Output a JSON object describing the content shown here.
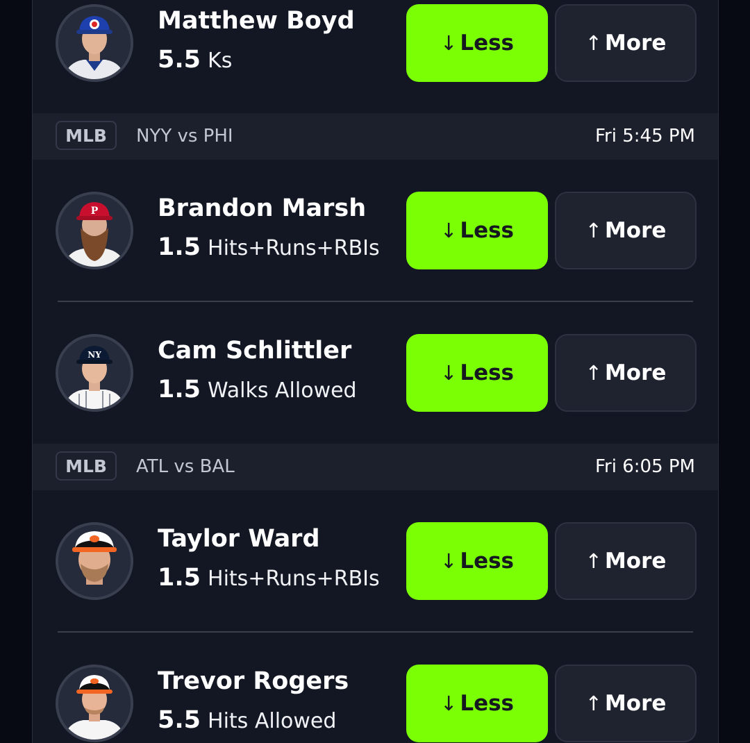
{
  "buttons": {
    "less": "Less",
    "more": "More",
    "less_arrow": "↓",
    "more_arrow": "↑"
  },
  "colors": {
    "less_button": "#7bff05",
    "background": "#131723",
    "header": "#1c202c"
  },
  "rows": [
    {
      "name": "Matthew Boyd",
      "line": "5.5",
      "stat": "Ks",
      "team_cap": "cubs-cap"
    },
    {
      "name": "Brandon Marsh",
      "line": "1.5",
      "stat": "Hits+Runs+RBIs",
      "team_cap": "phillies-cap"
    },
    {
      "name": "Cam Schlittler",
      "line": "1.5",
      "stat": "Walks Allowed",
      "team_cap": "yankees-cap"
    },
    {
      "name": "Taylor Ward",
      "line": "1.5",
      "stat": "Hits+Runs+RBIs",
      "team_cap": "orioles-cap"
    },
    {
      "name": "Trevor Rogers",
      "line": "5.5",
      "stat": "Hits Allowed",
      "team_cap": "orioles-cap"
    }
  ],
  "games": [
    {
      "league": "MLB",
      "matchup": "NYY vs PHI",
      "time": "Fri 5:45 PM"
    },
    {
      "league": "MLB",
      "matchup": "ATL vs BAL",
      "time": "Fri 6:05 PM"
    }
  ]
}
